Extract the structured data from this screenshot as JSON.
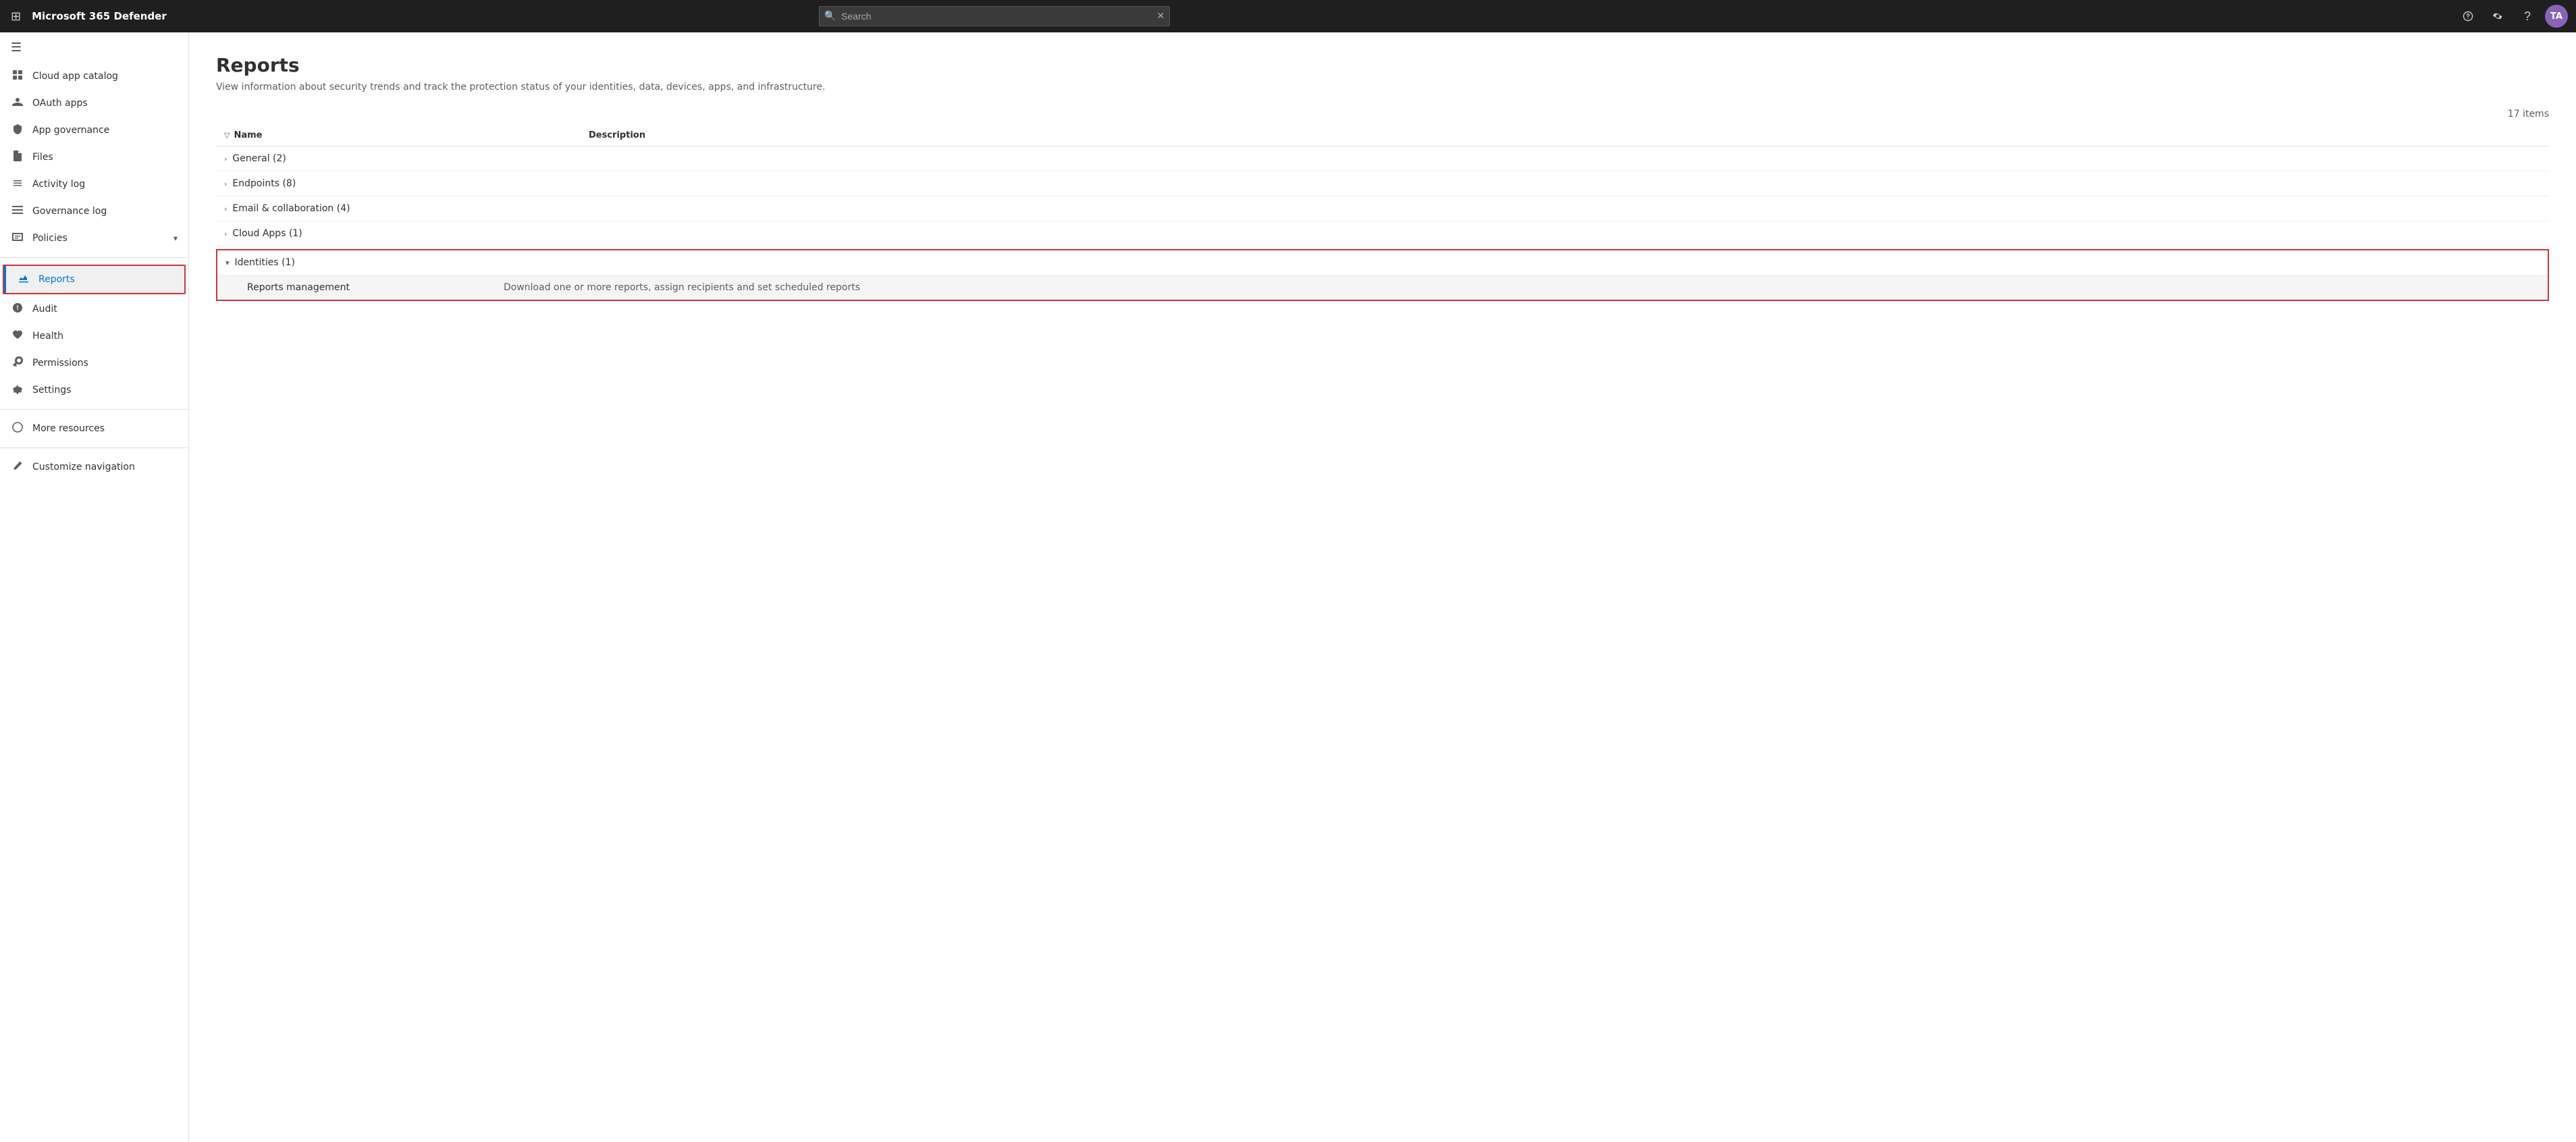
{
  "app": {
    "title": "Microsoft 365 Defender"
  },
  "topbar": {
    "title": "Microsoft 365 Defender",
    "search_placeholder": "Search",
    "avatar_initials": "TA"
  },
  "sidebar": {
    "toggle_label": "Collapse navigation",
    "items": [
      {
        "id": "cloud-app-catalog",
        "label": "Cloud app catalog",
        "icon": "grid"
      },
      {
        "id": "oauth-apps",
        "label": "OAuth apps",
        "icon": "id-badge"
      },
      {
        "id": "app-governance",
        "label": "App governance",
        "icon": "shield"
      },
      {
        "id": "files",
        "label": "Files",
        "icon": "document"
      },
      {
        "id": "activity-log",
        "label": "Activity log",
        "icon": "list"
      },
      {
        "id": "governance-log",
        "label": "Governance log",
        "icon": "list-alt"
      },
      {
        "id": "policies",
        "label": "Policies",
        "icon": "policy",
        "has_chevron": true
      },
      {
        "id": "reports",
        "label": "Reports",
        "icon": "chart",
        "active": true
      },
      {
        "id": "audit",
        "label": "Audit",
        "icon": "audit"
      },
      {
        "id": "health",
        "label": "Health",
        "icon": "heart"
      },
      {
        "id": "permissions",
        "label": "Permissions",
        "icon": "key"
      },
      {
        "id": "settings",
        "label": "Settings",
        "icon": "gear"
      },
      {
        "id": "more-resources",
        "label": "More resources",
        "icon": "info"
      },
      {
        "id": "customize-navigation",
        "label": "Customize navigation",
        "icon": "pencil"
      }
    ]
  },
  "page": {
    "title": "Reports",
    "subtitle": "View information about security trends and track the protection status of your identities, data, devices, apps, and infrastructure.",
    "items_count": "17 items",
    "table": {
      "col_name": "Name",
      "col_description": "Description",
      "groups": [
        {
          "id": "general",
          "name": "General (2)",
          "expanded": false,
          "children": []
        },
        {
          "id": "endpoints",
          "name": "Endpoints (8)",
          "expanded": false,
          "children": []
        },
        {
          "id": "email-collab",
          "name": "Email & collaboration (4)",
          "expanded": false,
          "children": []
        },
        {
          "id": "cloud-apps",
          "name": "Cloud Apps (1)",
          "expanded": false,
          "children": []
        },
        {
          "id": "identities",
          "name": "Identities (1)",
          "expanded": true,
          "highlighted": true,
          "children": [
            {
              "id": "reports-management",
              "name": "Reports management",
              "description": "Download one or more reports, assign recipients and set scheduled reports"
            }
          ]
        }
      ]
    }
  }
}
